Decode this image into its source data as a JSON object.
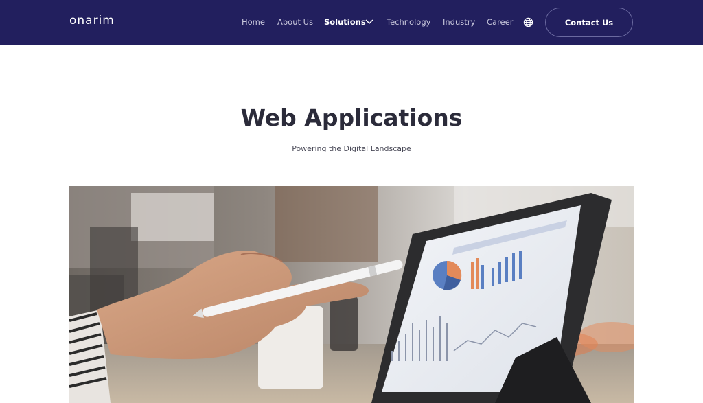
{
  "brand": {
    "logo_text": "onarim"
  },
  "nav": {
    "items": [
      {
        "label": "Home"
      },
      {
        "label": "About Us"
      },
      {
        "label": "Solutions"
      },
      {
        "label": "Technology"
      },
      {
        "label": "Industry"
      },
      {
        "label": "Career"
      }
    ],
    "active": "Solutions",
    "contact_label": "Contact Us"
  },
  "hero": {
    "title": "Web Applications",
    "subtitle": "Powering the Digital Landscape",
    "image_icon": "tablet-chart-photo"
  },
  "colors": {
    "navbar_bg": "#221f5e",
    "title_text": "#2b2b3a",
    "nav_text": "#c9c8dc"
  }
}
